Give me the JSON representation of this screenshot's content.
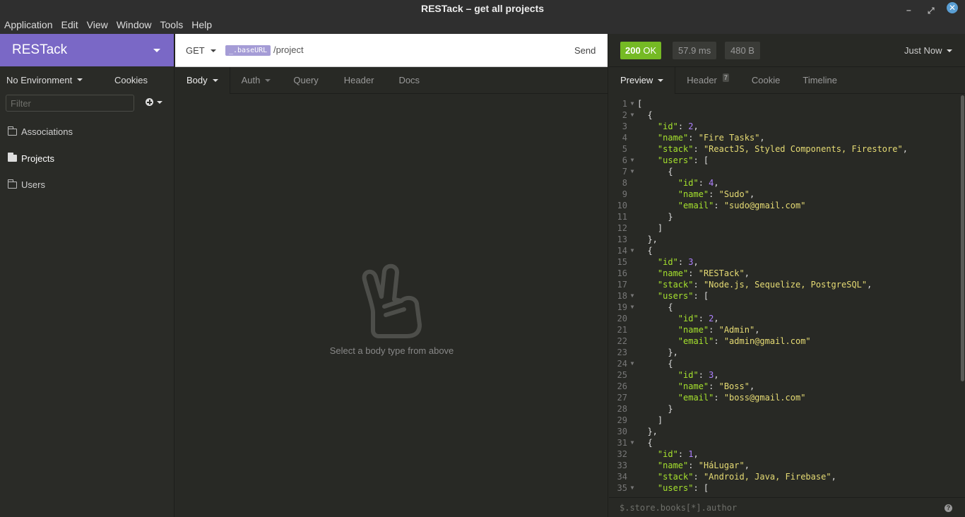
{
  "window": {
    "title": "RESTack – get all projects",
    "minimize": "–",
    "maximize": "⤢",
    "close": "✕"
  },
  "menu": [
    "Application",
    "Edit",
    "View",
    "Window",
    "Tools",
    "Help"
  ],
  "sidebar": {
    "workspace": "RESTack",
    "environment": "No Environment",
    "cookies": "Cookies",
    "filter_placeholder": "Filter",
    "folders": [
      {
        "label": "Associations",
        "active": false
      },
      {
        "label": "Projects",
        "active": true
      },
      {
        "label": "Users",
        "active": false
      }
    ]
  },
  "request": {
    "method": "GET",
    "url_variable": "_.baseURL",
    "url_path": "/project",
    "send_label": "Send",
    "tabs": [
      "Body",
      "Auth",
      "Query",
      "Header",
      "Docs"
    ],
    "empty_body_message": "Select a body type from above"
  },
  "response": {
    "status_code": "200",
    "status_text": "OK",
    "time": "57.9 ms",
    "size": "480 B",
    "history_label": "Just Now",
    "tabs": {
      "preview": "Preview",
      "header": "Header",
      "header_count": "7",
      "cookie": "Cookie",
      "timeline": "Timeline"
    },
    "jsonpath_placeholder": "$.store.books[*].author",
    "help": "?",
    "colors": {
      "status_ok": "#75ba24",
      "key": "#a6e22e",
      "string": "#e6db74",
      "number": "#ae81ff",
      "brand": "#7a68c6"
    },
    "code_lines": [
      {
        "n": "1",
        "fold": true,
        "tokens": [
          [
            "punc",
            "["
          ]
        ]
      },
      {
        "n": "2",
        "fold": true,
        "tokens": [
          [
            "punc",
            "  {"
          ]
        ]
      },
      {
        "n": "3",
        "fold": false,
        "tokens": [
          [
            "punc",
            "    "
          ],
          [
            "key",
            "\"id\""
          ],
          [
            "punc",
            ": "
          ],
          [
            "num",
            "2"
          ],
          [
            "punc",
            ","
          ]
        ]
      },
      {
        "n": "4",
        "fold": false,
        "tokens": [
          [
            "punc",
            "    "
          ],
          [
            "key",
            "\"name\""
          ],
          [
            "punc",
            ": "
          ],
          [
            "str",
            "\"Fire Tasks\""
          ],
          [
            "punc",
            ","
          ]
        ]
      },
      {
        "n": "5",
        "fold": false,
        "tokens": [
          [
            "punc",
            "    "
          ],
          [
            "key",
            "\"stack\""
          ],
          [
            "punc",
            ": "
          ],
          [
            "str",
            "\"ReactJS, Styled Components, Firestore\""
          ],
          [
            "punc",
            ","
          ]
        ]
      },
      {
        "n": "6",
        "fold": true,
        "tokens": [
          [
            "punc",
            "    "
          ],
          [
            "key",
            "\"users\""
          ],
          [
            "punc",
            ": ["
          ]
        ]
      },
      {
        "n": "7",
        "fold": true,
        "tokens": [
          [
            "punc",
            "      {"
          ]
        ]
      },
      {
        "n": "8",
        "fold": false,
        "tokens": [
          [
            "punc",
            "        "
          ],
          [
            "key",
            "\"id\""
          ],
          [
            "punc",
            ": "
          ],
          [
            "num",
            "4"
          ],
          [
            "punc",
            ","
          ]
        ]
      },
      {
        "n": "9",
        "fold": false,
        "tokens": [
          [
            "punc",
            "        "
          ],
          [
            "key",
            "\"name\""
          ],
          [
            "punc",
            ": "
          ],
          [
            "str",
            "\"Sudo\""
          ],
          [
            "punc",
            ","
          ]
        ]
      },
      {
        "n": "10",
        "fold": false,
        "tokens": [
          [
            "punc",
            "        "
          ],
          [
            "key",
            "\"email\""
          ],
          [
            "punc",
            ": "
          ],
          [
            "str",
            "\"sudo@gmail.com\""
          ]
        ]
      },
      {
        "n": "11",
        "fold": false,
        "tokens": [
          [
            "punc",
            "      }"
          ]
        ]
      },
      {
        "n": "12",
        "fold": false,
        "tokens": [
          [
            "punc",
            "    ]"
          ]
        ]
      },
      {
        "n": "13",
        "fold": false,
        "tokens": [
          [
            "punc",
            "  },"
          ]
        ]
      },
      {
        "n": "14",
        "fold": true,
        "tokens": [
          [
            "punc",
            "  {"
          ]
        ]
      },
      {
        "n": "15",
        "fold": false,
        "tokens": [
          [
            "punc",
            "    "
          ],
          [
            "key",
            "\"id\""
          ],
          [
            "punc",
            ": "
          ],
          [
            "num",
            "3"
          ],
          [
            "punc",
            ","
          ]
        ]
      },
      {
        "n": "16",
        "fold": false,
        "tokens": [
          [
            "punc",
            "    "
          ],
          [
            "key",
            "\"name\""
          ],
          [
            "punc",
            ": "
          ],
          [
            "str",
            "\"RESTack\""
          ],
          [
            "punc",
            ","
          ]
        ]
      },
      {
        "n": "17",
        "fold": false,
        "tokens": [
          [
            "punc",
            "    "
          ],
          [
            "key",
            "\"stack\""
          ],
          [
            "punc",
            ": "
          ],
          [
            "str",
            "\"Node.js, Sequelize, PostgreSQL\""
          ],
          [
            "punc",
            ","
          ]
        ]
      },
      {
        "n": "18",
        "fold": true,
        "tokens": [
          [
            "punc",
            "    "
          ],
          [
            "key",
            "\"users\""
          ],
          [
            "punc",
            ": ["
          ]
        ]
      },
      {
        "n": "19",
        "fold": true,
        "tokens": [
          [
            "punc",
            "      {"
          ]
        ]
      },
      {
        "n": "20",
        "fold": false,
        "tokens": [
          [
            "punc",
            "        "
          ],
          [
            "key",
            "\"id\""
          ],
          [
            "punc",
            ": "
          ],
          [
            "num",
            "2"
          ],
          [
            "punc",
            ","
          ]
        ]
      },
      {
        "n": "21",
        "fold": false,
        "tokens": [
          [
            "punc",
            "        "
          ],
          [
            "key",
            "\"name\""
          ],
          [
            "punc",
            ": "
          ],
          [
            "str",
            "\"Admin\""
          ],
          [
            "punc",
            ","
          ]
        ]
      },
      {
        "n": "22",
        "fold": false,
        "tokens": [
          [
            "punc",
            "        "
          ],
          [
            "key",
            "\"email\""
          ],
          [
            "punc",
            ": "
          ],
          [
            "str",
            "\"admin@gmail.com\""
          ]
        ]
      },
      {
        "n": "23",
        "fold": false,
        "tokens": [
          [
            "punc",
            "      },"
          ]
        ]
      },
      {
        "n": "24",
        "fold": true,
        "tokens": [
          [
            "punc",
            "      {"
          ]
        ]
      },
      {
        "n": "25",
        "fold": false,
        "tokens": [
          [
            "punc",
            "        "
          ],
          [
            "key",
            "\"id\""
          ],
          [
            "punc",
            ": "
          ],
          [
            "num",
            "3"
          ],
          [
            "punc",
            ","
          ]
        ]
      },
      {
        "n": "26",
        "fold": false,
        "tokens": [
          [
            "punc",
            "        "
          ],
          [
            "key",
            "\"name\""
          ],
          [
            "punc",
            ": "
          ],
          [
            "str",
            "\"Boss\""
          ],
          [
            "punc",
            ","
          ]
        ]
      },
      {
        "n": "27",
        "fold": false,
        "tokens": [
          [
            "punc",
            "        "
          ],
          [
            "key",
            "\"email\""
          ],
          [
            "punc",
            ": "
          ],
          [
            "str",
            "\"boss@gmail.com\""
          ]
        ]
      },
      {
        "n": "28",
        "fold": false,
        "tokens": [
          [
            "punc",
            "      }"
          ]
        ]
      },
      {
        "n": "29",
        "fold": false,
        "tokens": [
          [
            "punc",
            "    ]"
          ]
        ]
      },
      {
        "n": "30",
        "fold": false,
        "tokens": [
          [
            "punc",
            "  },"
          ]
        ]
      },
      {
        "n": "31",
        "fold": true,
        "tokens": [
          [
            "punc",
            "  {"
          ]
        ]
      },
      {
        "n": "32",
        "fold": false,
        "tokens": [
          [
            "punc",
            "    "
          ],
          [
            "key",
            "\"id\""
          ],
          [
            "punc",
            ": "
          ],
          [
            "num",
            "1"
          ],
          [
            "punc",
            ","
          ]
        ]
      },
      {
        "n": "33",
        "fold": false,
        "tokens": [
          [
            "punc",
            "    "
          ],
          [
            "key",
            "\"name\""
          ],
          [
            "punc",
            ": "
          ],
          [
            "str",
            "\"HáLugar\""
          ],
          [
            "punc",
            ","
          ]
        ]
      },
      {
        "n": "34",
        "fold": false,
        "tokens": [
          [
            "punc",
            "    "
          ],
          [
            "key",
            "\"stack\""
          ],
          [
            "punc",
            ": "
          ],
          [
            "str",
            "\"Android, Java, Firebase\""
          ],
          [
            "punc",
            ","
          ]
        ]
      },
      {
        "n": "35",
        "fold": true,
        "tokens": [
          [
            "punc",
            "    "
          ],
          [
            "key",
            "\"users\""
          ],
          [
            "punc",
            ": ["
          ]
        ]
      }
    ]
  }
}
